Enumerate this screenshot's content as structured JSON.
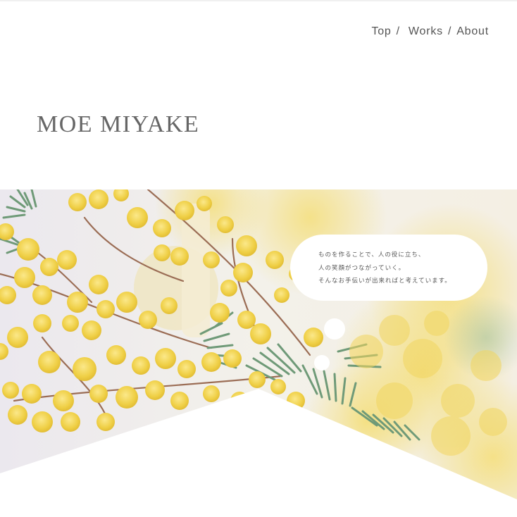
{
  "nav": {
    "items": [
      {
        "label": "Top"
      },
      {
        "label": "Works"
      },
      {
        "label": "About"
      }
    ],
    "separator": "/"
  },
  "site": {
    "title": "MOE MIYAKE"
  },
  "hero": {
    "image_subject": "mimosa flowers",
    "message_lines": [
      "ものを作ることで、人の役に立ち、",
      "人の笑顔がつながっていく。",
      "そんなお手伝いが出来ればと考えています。"
    ]
  },
  "colors": {
    "text": "#555555",
    "title": "#666666",
    "background": "#ffffff",
    "mimosa_yellow": "#f3d54a",
    "leaf_green": "#6f9a78"
  }
}
